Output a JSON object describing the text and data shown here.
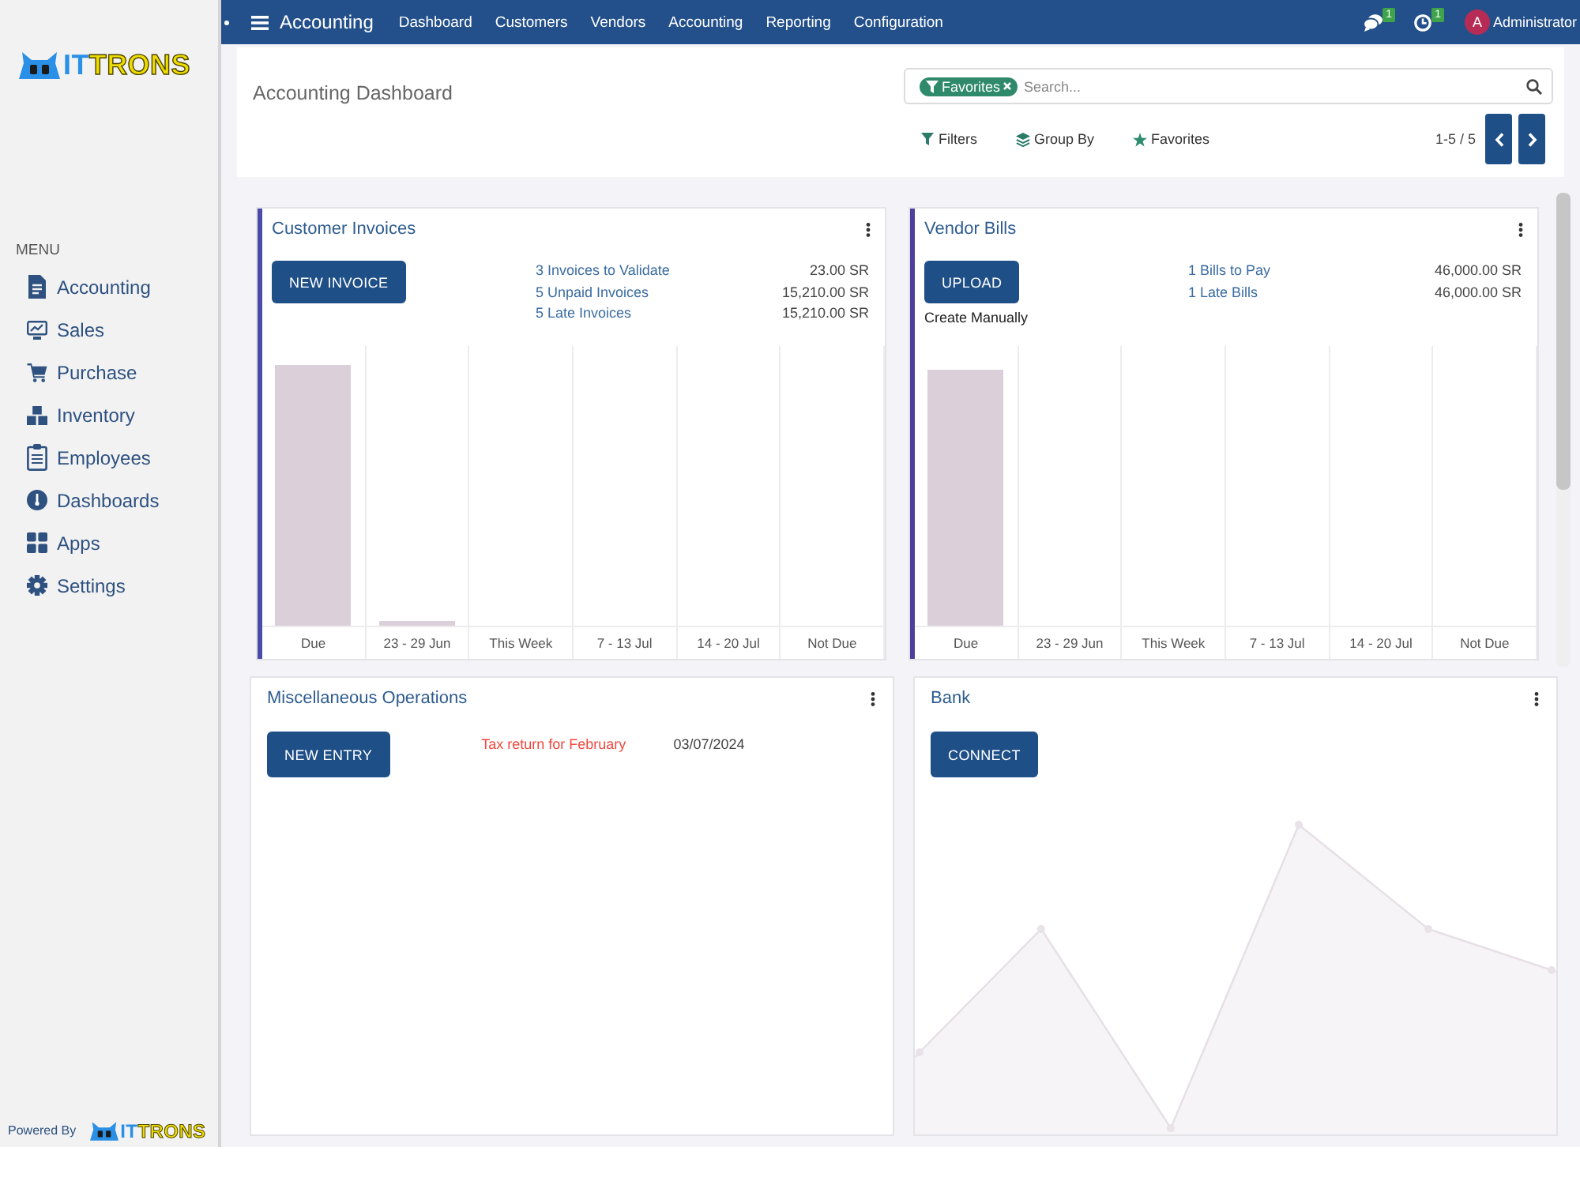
{
  "sidebar": {
    "logo": {
      "prefix": "IT",
      "suffix": "TRONS"
    },
    "menu_heading": "MENU",
    "items": [
      "Accounting",
      "Sales",
      "Purchase",
      "Inventory",
      "Employees",
      "Dashboards",
      "Apps",
      "Settings"
    ],
    "footer": {
      "label": "Powered By",
      "logo": {
        "prefix": "IT",
        "suffix": "TRONS"
      }
    }
  },
  "navbar": {
    "app_name": "Accounting",
    "menu": [
      "Dashboard",
      "Customers",
      "Vendors",
      "Accounting",
      "Reporting",
      "Configuration"
    ],
    "messages_badge": "1",
    "activities_badge": "1",
    "avatar_initial": "A",
    "user": "Administrator"
  },
  "control_panel": {
    "breadcrumb": "Accounting Dashboard",
    "search": {
      "facet": "Favorites",
      "placeholder": "Search..."
    },
    "filters": [
      "Filters",
      "Group By",
      "Favorites"
    ],
    "pager": "1-5 / 5"
  },
  "cards": [
    {
      "kind": "sale",
      "title": "Customer Invoices",
      "color": "#4a4aa8",
      "button": "NEW INVOICE",
      "stats": [
        {
          "label": "3 Invoices to Validate",
          "amount": "23.00 SR"
        },
        {
          "label": "5 Unpaid Invoices",
          "amount": "15,210.00 SR"
        },
        {
          "label": "5 Late Invoices",
          "amount": "15,210.00 SR"
        }
      ],
      "chart": {
        "labels": [
          "Due",
          "23 - 29 Jun",
          "This Week",
          "7 - 13 Jul",
          "14 - 20 Jul",
          "Not Due"
        ]
      }
    },
    {
      "kind": "purchase",
      "title": "Vendor Bills",
      "color": "#4e3f9e",
      "button": "UPLOAD",
      "link": "Create Manually",
      "stats": [
        {
          "label": "1 Bills to Pay",
          "amount": "46,000.00 SR"
        },
        {
          "label": "1 Late Bills",
          "amount": "46,000.00 SR"
        }
      ],
      "chart": {
        "labels": [
          "Due",
          "23 - 29 Jun",
          "This Week",
          "7 - 13 Jul",
          "14 - 20 Jul",
          "Not Due"
        ]
      }
    },
    {
      "kind": "general",
      "title": "Miscellaneous Operations",
      "button": "NEW ENTRY",
      "alerts": [
        {
          "label": "Tax return for February",
          "date": "03/07/2024",
          "overdue": true
        }
      ]
    },
    {
      "kind": "bank",
      "title": "Bank",
      "button": "CONNECT"
    }
  ]
}
